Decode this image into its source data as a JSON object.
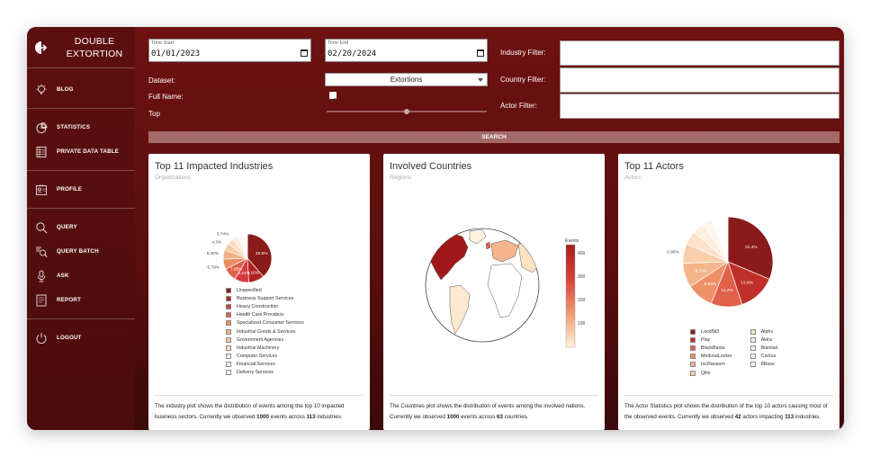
{
  "brand": {
    "line1": "DOUBLE",
    "line2": "EXTORTION"
  },
  "nav": {
    "blog": "BLOG",
    "statistics": "STATISTICS",
    "private_data_table": "PRIVATE DATA TABLE",
    "profile": "PROFILE",
    "query": "QUERY",
    "query_batch": "QUERY BATCH",
    "ask": "ASK",
    "report": "REPORT",
    "logout": "LOGOUT"
  },
  "filters": {
    "time_start_label": "Time Start",
    "time_start_value": "01/01/2023",
    "time_end_label": "Time End",
    "time_end_value": "02/20/2024",
    "dataset_label": "Dataset:",
    "dataset_value": "Extortions",
    "full_name_label": "Full Name:",
    "full_name_checked": true,
    "top_label": "Top",
    "top_value": 0.5,
    "industry_filter_label": "Industry Filter:",
    "country_filter_label": "Country Filter:",
    "actor_filter_label": "Actor Filter:",
    "search_label": "SEARCH"
  },
  "industries_card": {
    "title": "Top 11 Impacted Industries",
    "subtitle": "Organizations",
    "desc_pre": "The industry plot shows the distribution of events among the top 10 impacted business sectors. Currently we observed ",
    "events": "1000",
    "desc_mid": " events across ",
    "count": "113",
    "desc_post": " industries."
  },
  "countries_card": {
    "title": "Involved Countries",
    "subtitle": "Regions",
    "colorbar_title": "Events",
    "colorbar_ticks": [
      "400",
      "300",
      "200",
      "100"
    ],
    "desc_pre": "The Countries plot shows the distribution of events among the involved nations. Currently we observed ",
    "events": "1000",
    "desc_mid": " events across ",
    "count": "63",
    "desc_post": " countries."
  },
  "actors_card": {
    "title": "Top 11 Actors",
    "subtitle": "Actors",
    "desc_pre": "The Actor Statistics plot shows the distribution of the top 10 actors causing most of the observed events. Currently we observed ",
    "events": "42",
    "desc_mid": " actors impacting ",
    "count": "113",
    "desc_post": " industries."
  },
  "chart_data": [
    {
      "type": "pie",
      "labels": [
        "Unspecified",
        "Business Support Services",
        "Heavy Construction",
        "Health Care Providers",
        "Specialized Consumer Services",
        "Industrial Goods & Services",
        "Government Agencies",
        "Industrial Machinery",
        "Computer Services",
        "Financial Services",
        "Delivery Services"
      ],
      "values": [
        33.8,
        9.16,
        8.41,
        7.85,
        5.79,
        5.42,
        4.3,
        3.74,
        3.2,
        3.0,
        2.8
      ],
      "value_labels": [
        "33.8%",
        "9.16%",
        "8.41%",
        "7.85%",
        "5.79%",
        "5.42%",
        "4.3%",
        "3.74%",
        "",
        "",
        ""
      ],
      "colors": [
        "#8b1a1a",
        "#b22222",
        "#d43c3c",
        "#e0604a",
        "#ec8a62",
        "#f3b084",
        "#f6cba3",
        "#f8ddc0",
        "#fbeedd",
        "#fdf7ef",
        "#ffffff"
      ],
      "legend": "bottom"
    },
    {
      "type": "pie",
      "labels": [
        "LockBit3",
        "Play",
        "BlackBasta",
        "MedusaLocker",
        "IncRansom",
        "Qilin",
        "Alphv",
        "Akira",
        "Bianlian",
        "Cactus",
        "8Base"
      ],
      "values": [
        31.3,
        13.6,
        11.2,
        9.64,
        8.76,
        6.95,
        5.0,
        4.2,
        3.6,
        3.2,
        2.55
      ],
      "value_labels": [
        "31.3%",
        "13.6%",
        "11.2%",
        "9.64%",
        "8.76%",
        "6.95%",
        "",
        "",
        "",
        "",
        ""
      ],
      "colors": [
        "#8b1a1a",
        "#c0302a",
        "#e0604a",
        "#f09068",
        "#f5b48a",
        "#f8cfaa",
        "#fbe2c8",
        "#fdeedd",
        "#fef5ec",
        "#ffffff",
        "#ffffff"
      ],
      "legend": "bottom"
    }
  ]
}
